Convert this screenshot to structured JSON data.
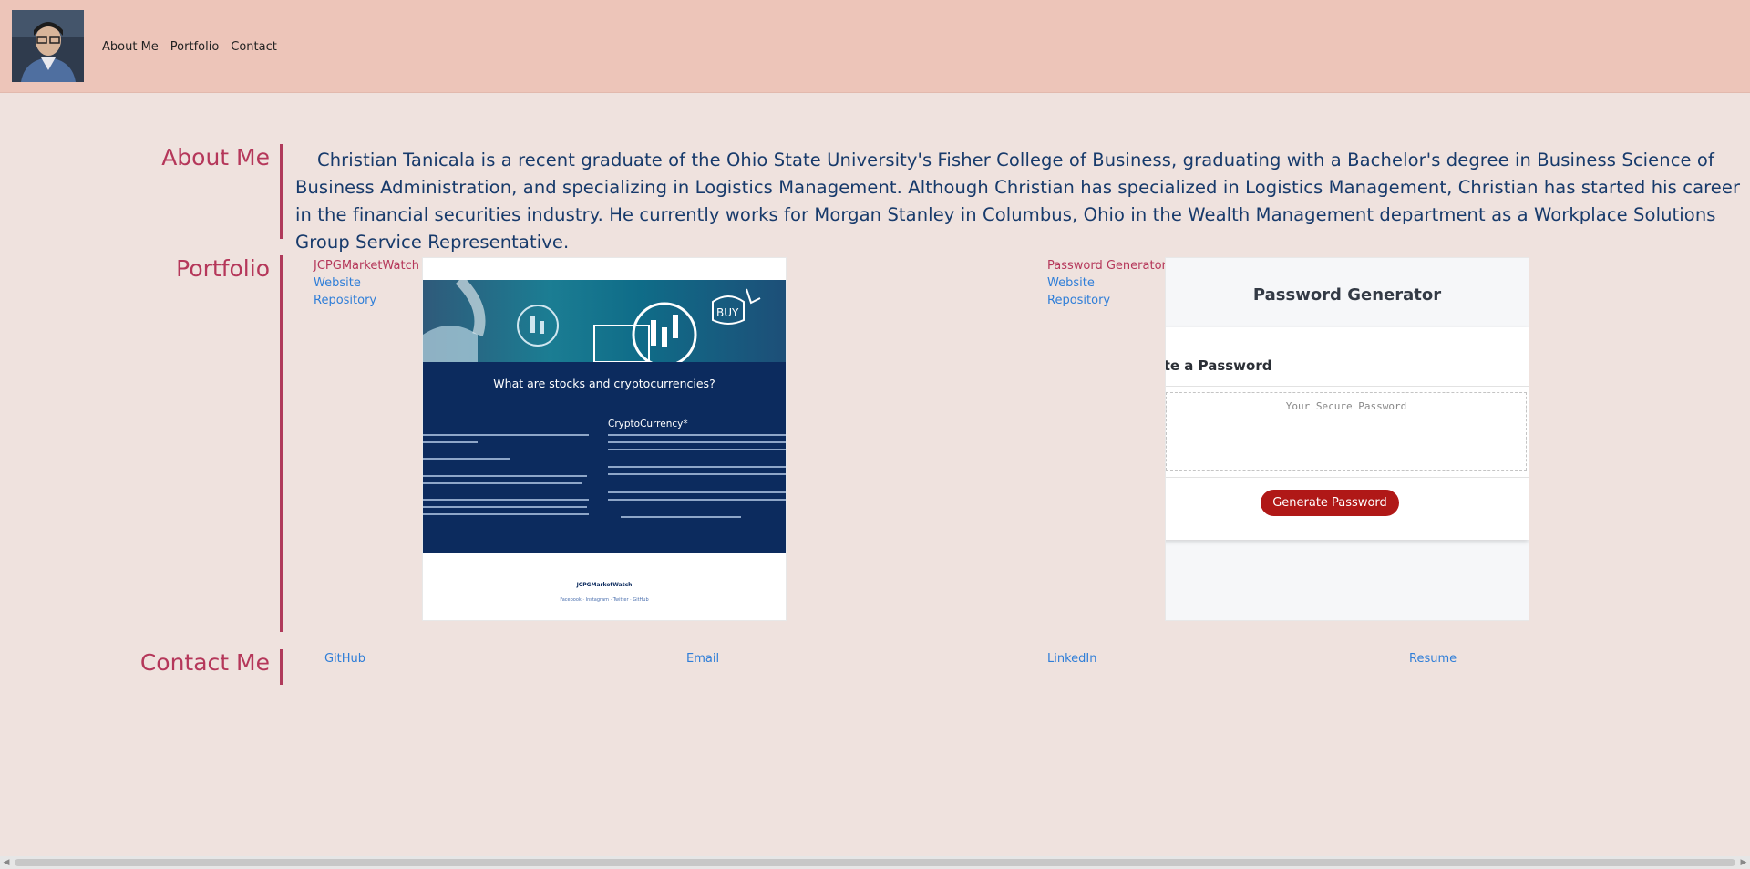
{
  "nav": {
    "items": [
      "About Me",
      "Portfolio",
      "Contact"
    ]
  },
  "about": {
    "title": "About Me",
    "text": "Christian Tanicala is a recent graduate of the Ohio State University's Fisher College of Business, graduating with a Bachelor's degree in Business Science of Business Administration, and specializing in Logistics Management. Although Christian has specialized in Logistics Management, Christian has started his career in the financial securities industry. He currently works for Morgan Stanley in Columbus, Ohio in the Wealth Management department as a Workplace Solutions Group Service Representative."
  },
  "portfolio": {
    "title": "Portfolio",
    "projects": [
      {
        "name": "JCPGMarketWatch",
        "website": "Website",
        "repository": "Repository",
        "screenshot": {
          "heading": "What are stocks and cryptocurrencies?",
          "subheading": "CryptoCurrency*",
          "footer_logo": "JCPGMarketWatch",
          "footer_links": "Facebook · Instagram · Twitter · GitHub"
        }
      },
      {
        "name": "Password Generator",
        "website": "Website",
        "repository": "Repository",
        "screenshot": {
          "header": "Password Generator",
          "card_title": "erate a Password",
          "placeholder": "Your Secure Password",
          "button": "Generate Password"
        }
      }
    ]
  },
  "contact": {
    "title": "Contact Me",
    "links": [
      "GitHub",
      "Email",
      "LinkedIn",
      "Resume"
    ]
  },
  "colors": {
    "header_bg": "#edc5b9",
    "page_bg": "#efe2de",
    "accent": "#b5375a",
    "link": "#2f7ed8",
    "about_text": "#173a6b"
  }
}
